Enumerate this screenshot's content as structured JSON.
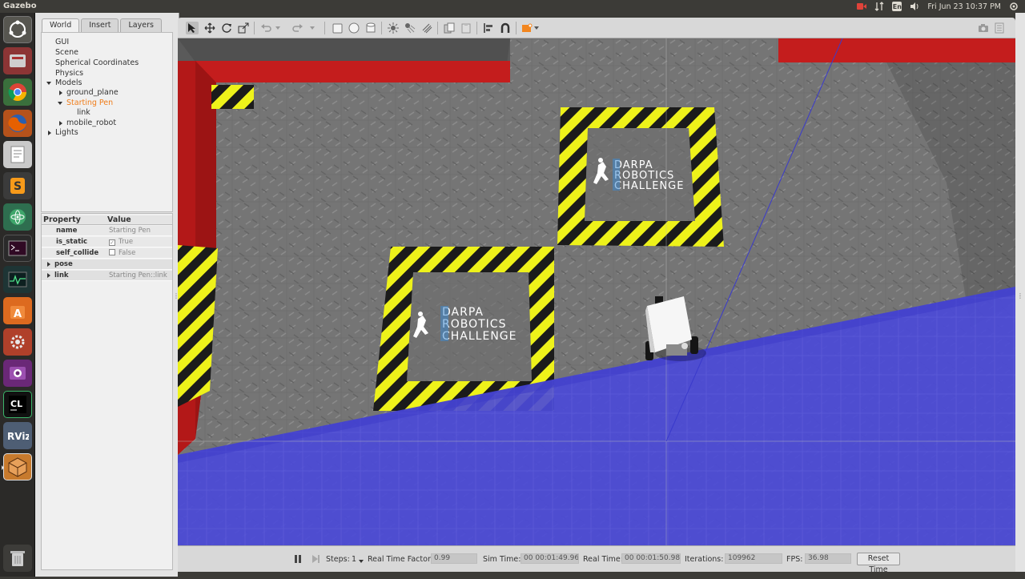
{
  "top_panel": {
    "app_title": "Gazebo",
    "keyboard_layout": "En",
    "clock": "Fri Jun 23 10:37 PM"
  },
  "launcher": {
    "items": [
      {
        "name": "ubuntu-dash-icon",
        "color": "#4a4a4a"
      },
      {
        "name": "files-icon",
        "color": "#9b3a3a"
      },
      {
        "name": "chrome-icon",
        "color": "#2f7d32"
      },
      {
        "name": "firefox-icon",
        "color": "#d9611c"
      },
      {
        "name": "text-editor-icon",
        "color": "#cfcfcf"
      },
      {
        "name": "sublime-icon",
        "color": "#333333"
      },
      {
        "name": "atom-icon",
        "color": "#2e7d55"
      },
      {
        "name": "terminal-icon",
        "color": "#2a2a2a"
      },
      {
        "name": "system-monitor-icon",
        "color": "#1f3b3b"
      },
      {
        "name": "software-center-icon",
        "color": "#dd6a1f"
      },
      {
        "name": "settings-icon",
        "color": "#c44b2c"
      },
      {
        "name": "video-icon",
        "color": "#7a2f86"
      },
      {
        "name": "clion-icon",
        "color": "#1c6f3d"
      },
      {
        "name": "rviz-icon",
        "color": "#5c6d86"
      },
      {
        "name": "gazebo-icon",
        "color": "#c77a2d"
      }
    ],
    "clion_label": "CL",
    "rviz_label": "RViz",
    "trash_name": "trash-icon"
  },
  "left_panel": {
    "tabs": [
      "World",
      "Insert",
      "Layers"
    ],
    "tree": {
      "gui": "GUI",
      "scene": "Scene",
      "spherical": "Spherical Coordinates",
      "physics": "Physics",
      "models": "Models",
      "ground_plane": "ground_plane",
      "starting_pen": "Starting Pen",
      "link": "link",
      "mobile_robot": "mobile_robot",
      "lights": "Lights"
    },
    "properties": {
      "header_property": "Property",
      "header_value": "Value",
      "rows": [
        {
          "key": "name",
          "value": "Starting Pen"
        },
        {
          "key": "is_static",
          "value": "True",
          "checked": true
        },
        {
          "key": "self_collide",
          "value": "False",
          "checked": false
        },
        {
          "key": "pose",
          "value": ""
        },
        {
          "key": "link",
          "value": "Starting Pen::link"
        }
      ]
    }
  },
  "viewport": {
    "drc_logo_line1": "DARPA",
    "drc_logo_line2": "ROBOTICS",
    "drc_logo_line3": "CHALLENGE"
  },
  "bottom_bar": {
    "steps_label": "Steps:",
    "steps_value": "1",
    "rtf_label": "Real Time Factor:",
    "rtf_value": "0.99",
    "sim_time_label": "Sim Time:",
    "sim_time_value": "00 00:01:49.962",
    "real_time_label": "Real Time:",
    "real_time_value": "00 00:01:50.989",
    "iterations_label": "Iterations:",
    "iterations_value": "109962",
    "fps_label": "FPS:",
    "fps_value": "36.98",
    "reset_label": "Reset Time"
  }
}
